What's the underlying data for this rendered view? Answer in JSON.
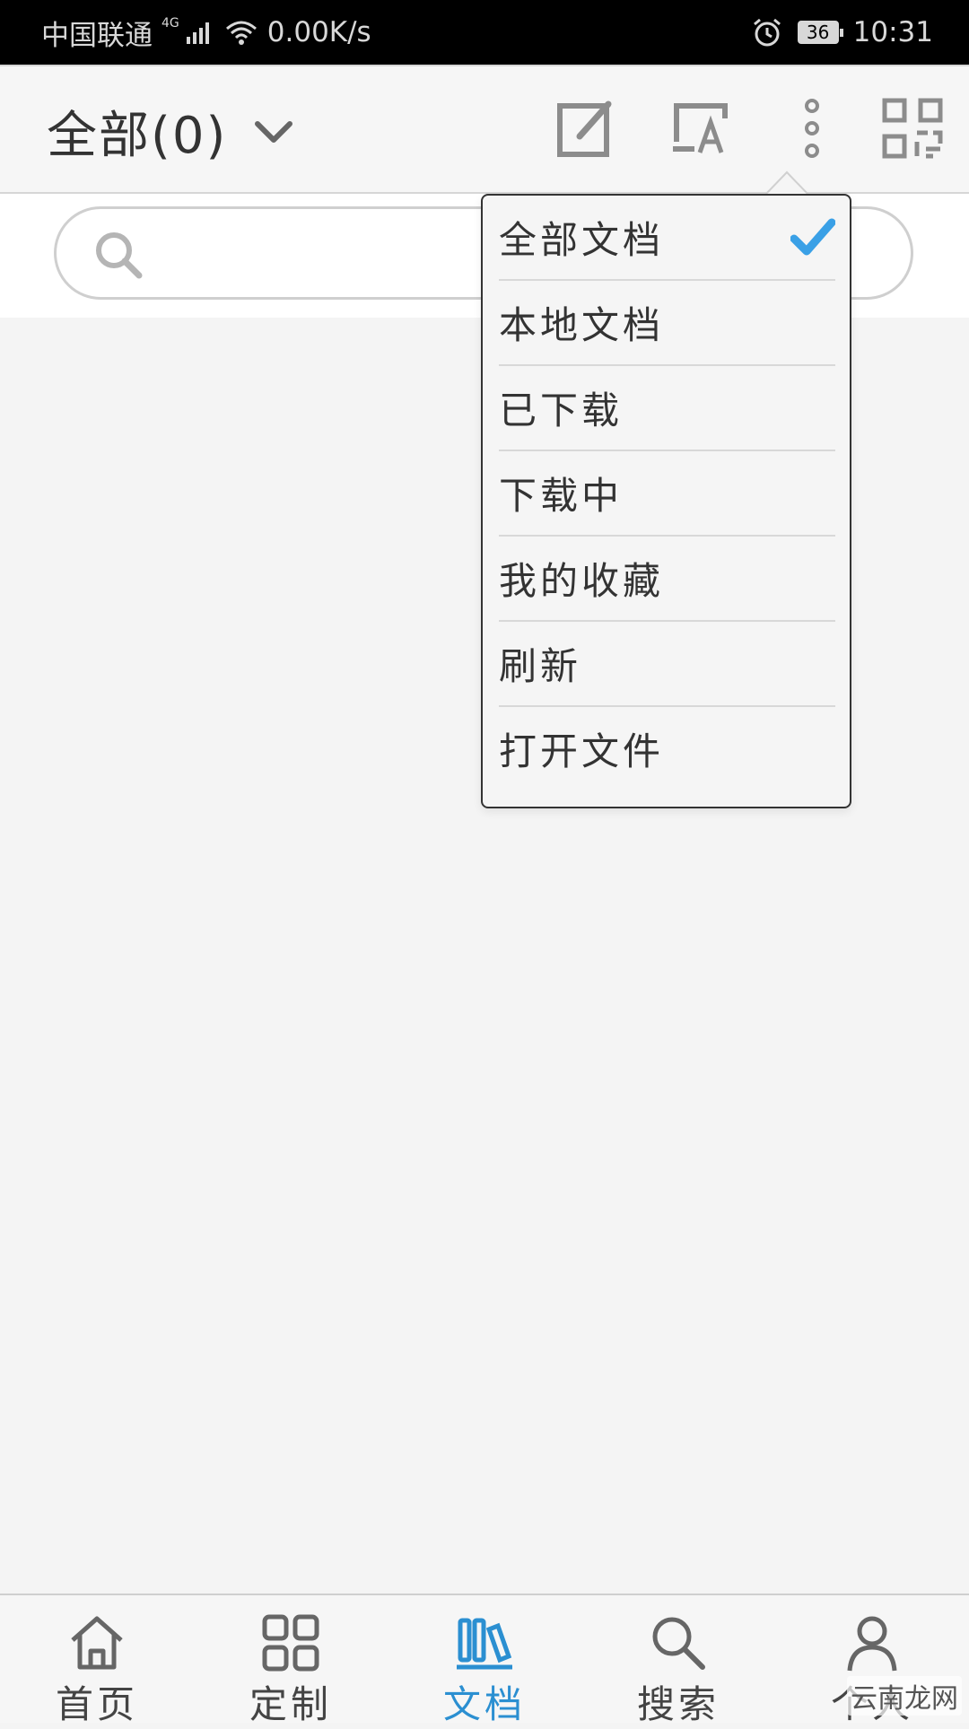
{
  "status_bar": {
    "carrier": "中国联通",
    "network_type": "4G",
    "speed": "0.00K/s",
    "battery": "36",
    "time": "10:31"
  },
  "header": {
    "title": "全部(0)",
    "icons": [
      "edit-icon",
      "screen-text-icon",
      "more-vertical-icon",
      "qr-code-icon"
    ]
  },
  "search": {
    "placeholder": ""
  },
  "menu": {
    "items": [
      {
        "label": "全部文档",
        "selected": true
      },
      {
        "label": "本地文档",
        "selected": false
      },
      {
        "label": "已下载",
        "selected": false
      },
      {
        "label": "下载中",
        "selected": false
      },
      {
        "label": "我的收藏",
        "selected": false
      },
      {
        "label": "刷新",
        "selected": false
      },
      {
        "label": "打开文件",
        "selected": false
      }
    ],
    "check_color": "#3aa0e6"
  },
  "bottom_nav": {
    "items": [
      {
        "label": "首页",
        "icon": "home-icon"
      },
      {
        "label": "定制",
        "icon": "grid-icon"
      },
      {
        "label": "文档",
        "icon": "books-icon",
        "active": true
      },
      {
        "label": "搜索",
        "icon": "search-icon"
      },
      {
        "label": "个人",
        "icon": "user-icon"
      }
    ],
    "active_color": "#2b8fd1"
  },
  "watermark": {
    "brand": "云南龙网"
  }
}
